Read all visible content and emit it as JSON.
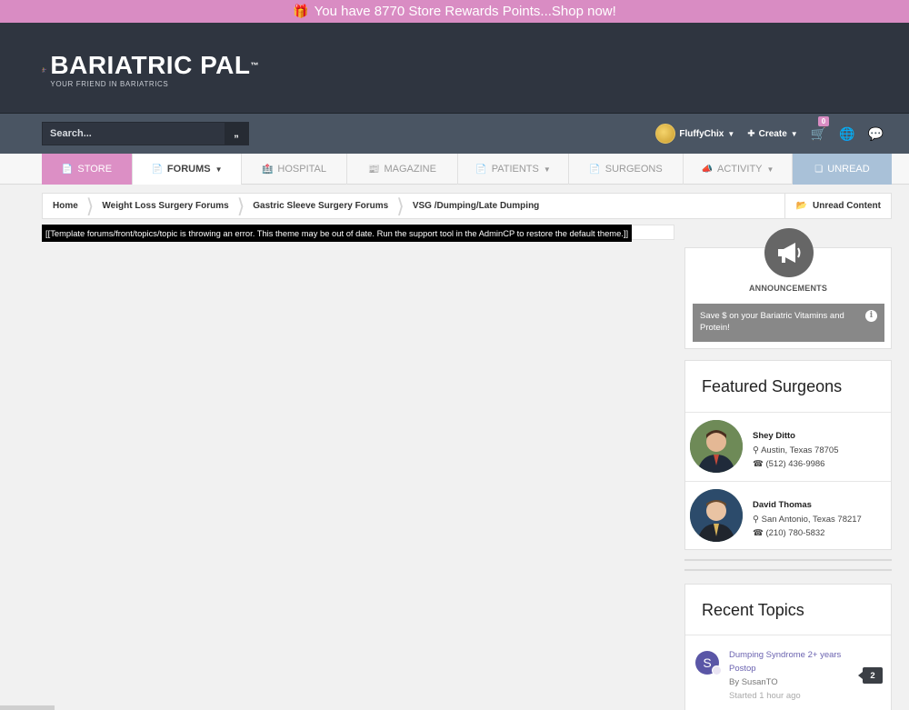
{
  "promo": {
    "text": "You have 8770 Store Rewards Points...Shop now!"
  },
  "brand": {
    "title": "BARIATRIC PAL",
    "trademark": "™",
    "tagline": "YOUR FRIEND IN BARIATRICS"
  },
  "search": {
    "placeholder": "Search..."
  },
  "user": {
    "name": "FluffyChix",
    "create_label": "Create",
    "cart_count": "0"
  },
  "nav": {
    "store": "STORE",
    "forums": "FORUMS",
    "hospital": "HOSPITAL",
    "magazine": "MAGAZINE",
    "patients": "PATIENTS",
    "surgeons": "SURGEONS",
    "activity": "ACTIVITY",
    "unread": "UNREAD"
  },
  "breadcrumb": {
    "items": [
      "Home",
      "Weight Loss Surgery Forums",
      "Gastric Sleeve Surgery Forums",
      "VSG /Dumping/Late Dumping"
    ],
    "unread_content": "Unread Content"
  },
  "error": {
    "message": "[[Template forums/front/topics/topic is throwing an error. This theme may be out of date. Run the support tool in the AdminCP to restore the default theme.]]"
  },
  "announcements": {
    "title": "ANNOUNCEMENTS",
    "items": [
      {
        "text": "Save $ on your Bariatric Vitamins and Protein!"
      }
    ]
  },
  "featured_surgeons": {
    "title": "Featured Surgeons",
    "items": [
      {
        "name": "Shey Ditto",
        "location": "Austin, Texas 78705",
        "phone": "(512) 436-9986"
      },
      {
        "name": "David Thomas",
        "location": "San Antonio, Texas 78217",
        "phone": "(210) 780-5832"
      }
    ]
  },
  "recent_topics": {
    "title": "Recent Topics",
    "items": [
      {
        "title": "Dumping Syndrome 2+ years Postop",
        "author": "By SusanTO",
        "time": "Started 1 hour ago",
        "replies": "2",
        "avatar_letter": "S"
      }
    ]
  },
  "colors": {
    "accent_pink": "#dc8fc5",
    "header_dark": "#2f3540",
    "userbar": "#4a5563",
    "unread_blue": "#a9c1d8"
  }
}
